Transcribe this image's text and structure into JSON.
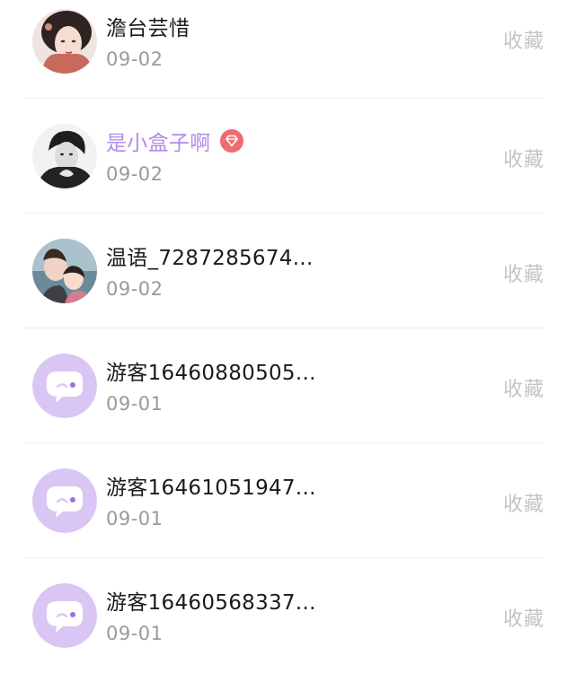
{
  "colors": {
    "name_text": "#1b1b1b",
    "vip_name_text": "#b28be8",
    "vip_badge": "#ef6b72",
    "date_text": "#9a9a9a",
    "action_text": "#c4c4c4",
    "divider": "#eeeeee",
    "guest_avatar_bg": "#d9c6f5"
  },
  "users": [
    {
      "name": "澹台芸惜",
      "date": "09-02",
      "action": "收藏",
      "avatar": "photo-avatar-woman",
      "vip": false
    },
    {
      "name": "是小盒子啊",
      "date": "09-02",
      "action": "收藏",
      "avatar": "photo-avatar-bw-man",
      "vip": true,
      "badge_icon": "diamond-badge-icon"
    },
    {
      "name": "温语_7287285674...",
      "date": "09-02",
      "action": "收藏",
      "avatar": "photo-avatar-couple",
      "vip": false
    },
    {
      "name": "游客16460880505...",
      "date": "09-01",
      "action": "收藏",
      "avatar": "chat-bubble-icon",
      "vip": false
    },
    {
      "name": "游客16461051947...",
      "date": "09-01",
      "action": "收藏",
      "avatar": "chat-bubble-icon",
      "vip": false
    },
    {
      "name": "游客16460568337...",
      "date": "09-01",
      "action": "收藏",
      "avatar": "chat-bubble-icon",
      "vip": false
    }
  ]
}
